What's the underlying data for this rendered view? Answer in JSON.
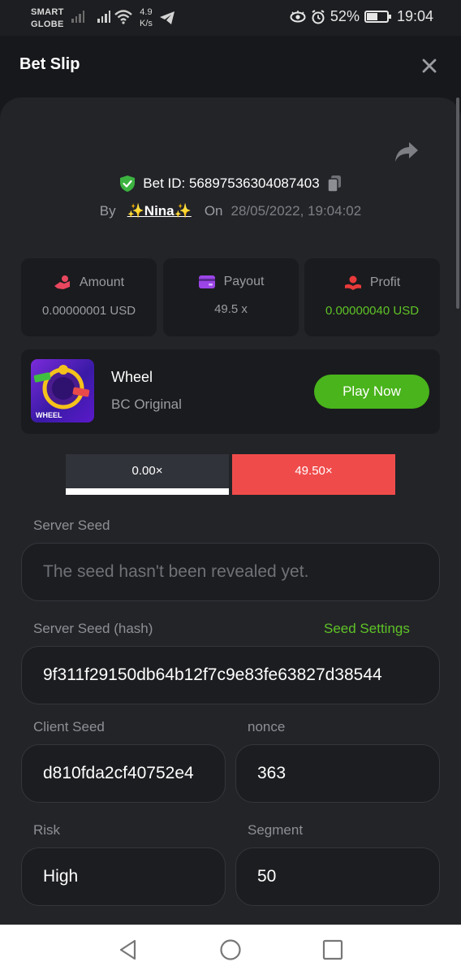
{
  "status_bar": {
    "carrier_line1": "SMART",
    "carrier_line2": "GLOBE",
    "speed_value": "4.9",
    "speed_unit": "K/s",
    "battery": "52%",
    "time": "19:04",
    "icons": [
      "signal-icon",
      "wifi-icon",
      "telegram-icon",
      "eye-icon",
      "alarm-icon",
      "battery-icon"
    ]
  },
  "header": {
    "title": "Bet Slip",
    "close_icon": "close-icon"
  },
  "bet": {
    "id_label": "Bet ID: 56897536304087403",
    "by_label": "By",
    "user": "✨Nina✨",
    "on_label": "On",
    "date": "28/05/2022, 19:04:02"
  },
  "stats": [
    {
      "label": "Amount",
      "value": "0.00000001 USD",
      "icon": "amount-icon",
      "color": "#e8475f"
    },
    {
      "label": "Payout",
      "value": "49.5 x",
      "icon": "wallet-icon",
      "color": "#9b45e6"
    },
    {
      "label": "Profit",
      "value": "0.00000040 USD",
      "icon": "profit-icon",
      "color": "#e83a3a"
    }
  ],
  "game": {
    "name": "Wheel",
    "subtitle": "BC Original",
    "thumb_label": "WHEEL",
    "play_button": "Play Now"
  },
  "result": {
    "left": "0.00×",
    "right": "49.50×"
  },
  "fields": {
    "server_seed_label": "Server Seed",
    "server_seed_value": "The seed hasn't been revealed yet.",
    "server_hash_label": "Server Seed (hash)",
    "seed_settings_link": "Seed Settings",
    "server_hash_value": "9f311f29150db64b12f7c9e83fe63827d38544",
    "client_seed_label": "Client Seed",
    "client_seed_value": "d810fda2cf40752e4",
    "nonce_label": "nonce",
    "nonce_value": "363",
    "risk_label": "Risk",
    "risk_value": "High",
    "segment_label": "Segment",
    "segment_value": "50"
  },
  "colors": {
    "accent_green": "#49b41b",
    "profit_green": "#5ec327",
    "result_red": "#f04b4b",
    "card_bg": "#232428"
  }
}
